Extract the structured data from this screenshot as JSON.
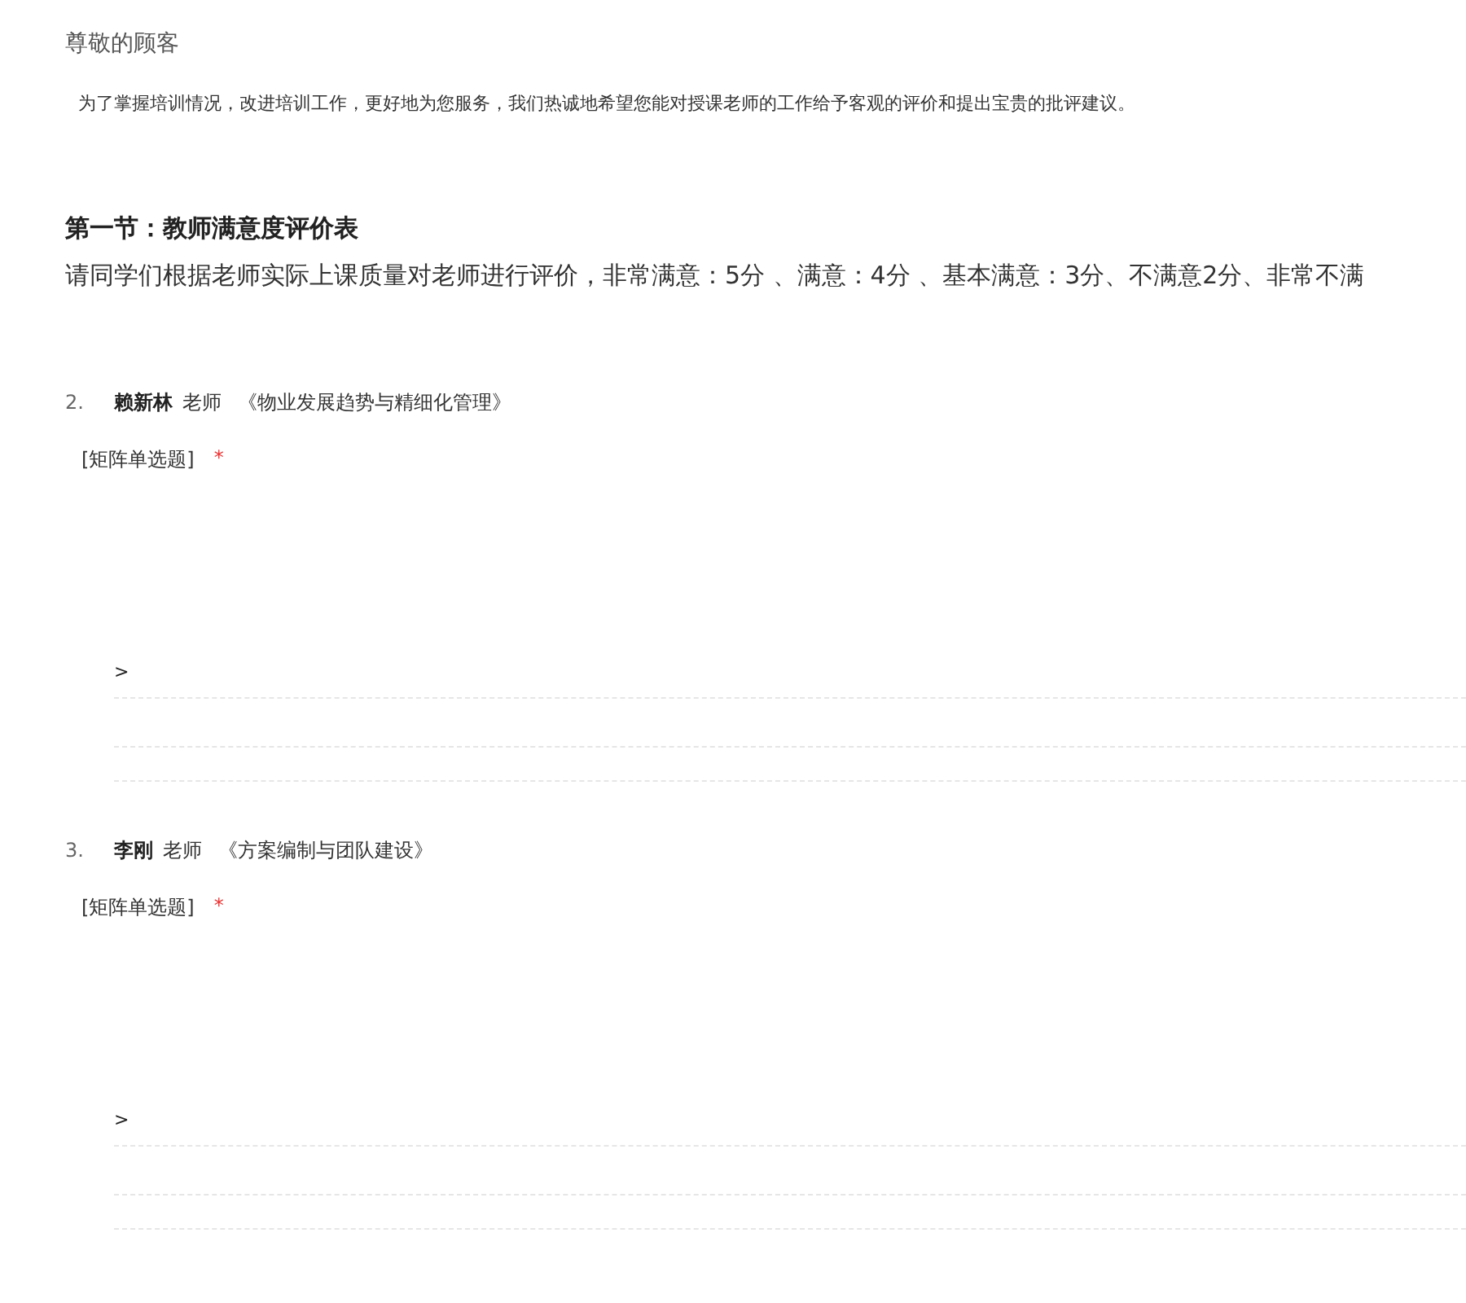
{
  "greeting": "尊敬的顾客",
  "intro": "为了掌握培训情况，改进培训工作，更好地为您服务，我们热诚地希望您能对授课老师的工作给予客观的评价和提出宝贵的批评建议。",
  "section": {
    "title": "第一节：教师满意度评价表",
    "description": "请同学们根据老师实际上课质量对老师进行评价，非常满意：5分 、满意：4分 、基本满意：3分、不满意2分、非常不满"
  },
  "questions": [
    {
      "number": "2.",
      "teacher": "赖新林",
      "role": "老师",
      "course": "《物业发展趋势与精细化管理》",
      "type": "[矩阵单选题]",
      "required_mark": "*",
      "marker": ">"
    },
    {
      "number": "3.",
      "teacher": "李刚",
      "role": "老师",
      "course": "《方案编制与团队建设》",
      "type": "[矩阵单选题]",
      "required_mark": "*",
      "marker": ">"
    }
  ]
}
